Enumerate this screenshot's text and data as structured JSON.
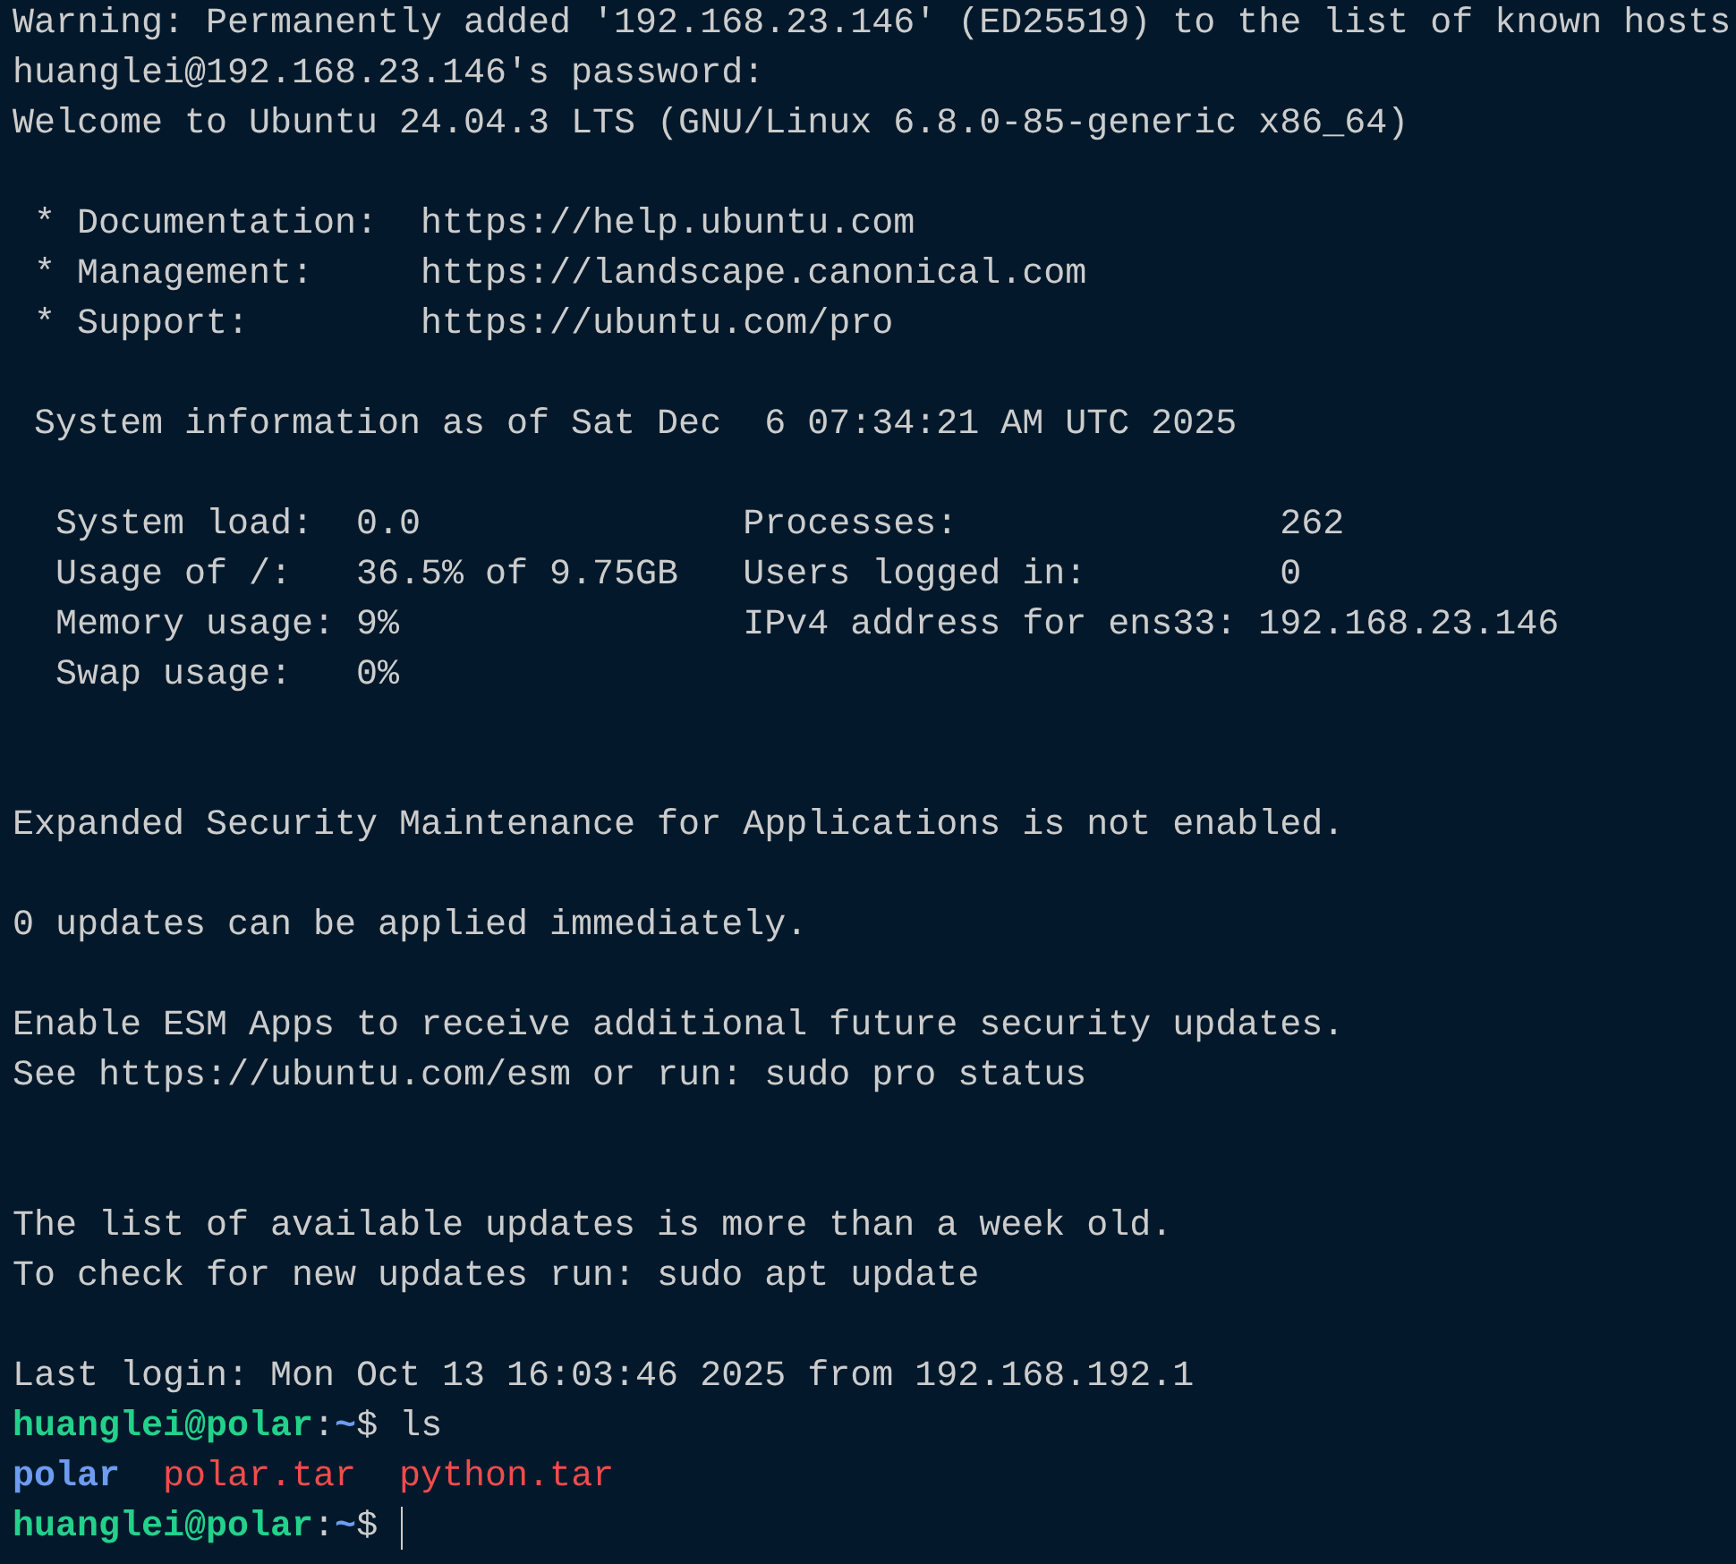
{
  "lines": [
    {
      "kind": "text",
      "spans": [
        {
          "kind": "plain",
          "text": "Warning: Permanently added '192.168.23.146' (ED25519) to the list of known hosts"
        }
      ]
    },
    {
      "kind": "text",
      "spans": [
        {
          "kind": "plain",
          "text": "huanglei@192.168.23.146's password:"
        }
      ]
    },
    {
      "kind": "text",
      "spans": [
        {
          "kind": "plain",
          "text": "Welcome to Ubuntu 24.04.3 LTS (GNU/Linux 6.8.0-85-generic x86_64)"
        }
      ]
    },
    {
      "kind": "blank"
    },
    {
      "kind": "text",
      "spans": [
        {
          "kind": "plain",
          "text": " * Documentation:  https://help.ubuntu.com"
        }
      ]
    },
    {
      "kind": "text",
      "spans": [
        {
          "kind": "plain",
          "text": " * Management:     https://landscape.canonical.com"
        }
      ]
    },
    {
      "kind": "text",
      "spans": [
        {
          "kind": "plain",
          "text": " * Support:        https://ubuntu.com/pro"
        }
      ]
    },
    {
      "kind": "blank"
    },
    {
      "kind": "text",
      "spans": [
        {
          "kind": "plain",
          "text": " System information as of Sat Dec  6 07:34:21 AM UTC 2025"
        }
      ]
    },
    {
      "kind": "blank"
    },
    {
      "kind": "text",
      "spans": [
        {
          "kind": "plain",
          "text": "  System load:  0.0               Processes:               262"
        }
      ]
    },
    {
      "kind": "text",
      "spans": [
        {
          "kind": "plain",
          "text": "  Usage of /:   36.5% of 9.75GB   Users logged in:         0"
        }
      ]
    },
    {
      "kind": "text",
      "spans": [
        {
          "kind": "plain",
          "text": "  Memory usage: 9%                IPv4 address for ens33: 192.168.23.146"
        }
      ]
    },
    {
      "kind": "text",
      "spans": [
        {
          "kind": "plain",
          "text": "  Swap usage:   0%"
        }
      ]
    },
    {
      "kind": "blank"
    },
    {
      "kind": "blank"
    },
    {
      "kind": "text",
      "spans": [
        {
          "kind": "plain",
          "text": "Expanded Security Maintenance for Applications is not enabled."
        }
      ]
    },
    {
      "kind": "blank"
    },
    {
      "kind": "text",
      "spans": [
        {
          "kind": "plain",
          "text": "0 updates can be applied immediately."
        }
      ]
    },
    {
      "kind": "blank"
    },
    {
      "kind": "text",
      "spans": [
        {
          "kind": "plain",
          "text": "Enable ESM Apps to receive additional future security updates."
        }
      ]
    },
    {
      "kind": "text",
      "spans": [
        {
          "kind": "plain",
          "text": "See https://ubuntu.com/esm or run: sudo pro status"
        }
      ]
    },
    {
      "kind": "blank"
    },
    {
      "kind": "blank"
    },
    {
      "kind": "text",
      "spans": [
        {
          "kind": "plain",
          "text": "The list of available updates is more than a week old."
        }
      ]
    },
    {
      "kind": "text",
      "spans": [
        {
          "kind": "plain",
          "text": "To check for new updates run: sudo apt update"
        }
      ]
    },
    {
      "kind": "blank"
    },
    {
      "kind": "text",
      "spans": [
        {
          "kind": "plain",
          "text": "Last login: Mon Oct 13 16:03:46 2025 from 192.168.192.1"
        }
      ]
    },
    {
      "kind": "text",
      "spans": [
        {
          "kind": "user",
          "text": "huanglei@polar"
        },
        {
          "kind": "plain",
          "text": ":"
        },
        {
          "kind": "path",
          "text": "~"
        },
        {
          "kind": "plain",
          "text": "$ ls"
        }
      ]
    },
    {
      "kind": "text",
      "spans": [
        {
          "kind": "dir",
          "text": "polar"
        },
        {
          "kind": "archive",
          "text": "polar.tar"
        },
        {
          "kind": "archive",
          "text": "python.tar"
        }
      ]
    },
    {
      "kind": "prompt",
      "spans": [
        {
          "kind": "user",
          "text": "huanglei@polar"
        },
        {
          "kind": "plain",
          "text": ":"
        },
        {
          "kind": "path",
          "text": "~"
        },
        {
          "kind": "plain",
          "text": "$"
        }
      ]
    }
  ]
}
